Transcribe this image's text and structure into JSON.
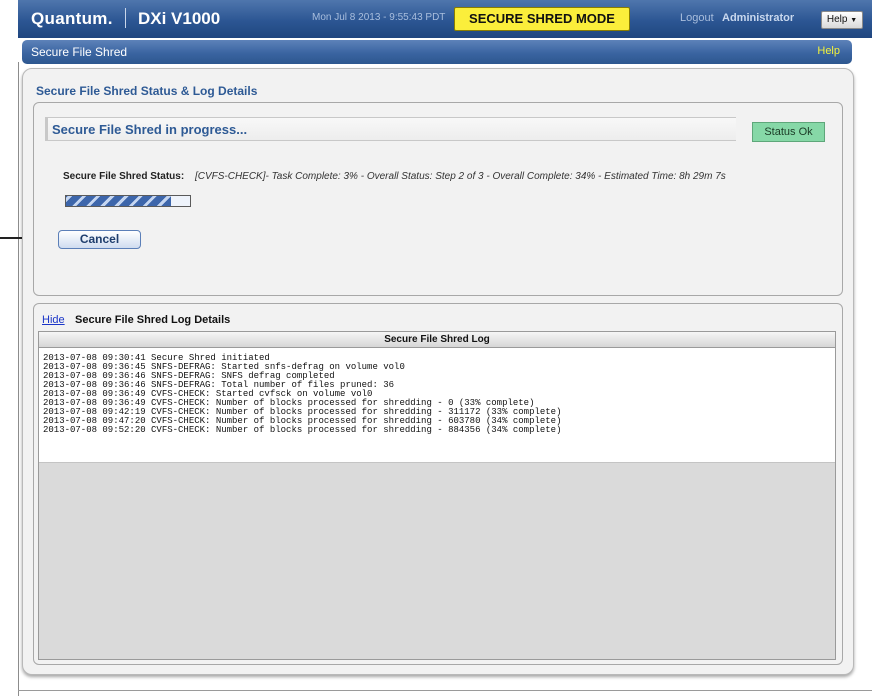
{
  "header": {
    "brand": "Quantum.",
    "product": "DXi V1000",
    "datetime": "Mon Jul 8 2013 - 9:55:43 PDT",
    "mode": "SECURE SHRED MODE",
    "logout": "Logout",
    "user": "Administrator",
    "help_menu": "Help"
  },
  "page": {
    "title": "Secure File Shred",
    "help": "Help"
  },
  "status_section": {
    "title": "Secure File Shred Status & Log Details",
    "progress_title": "Secure File Shred in progress...",
    "status_badge": "Status Ok",
    "status_label": "Secure File Shred Status:",
    "status_value": "[CVFS-CHECK]- Task Complete: 3% - Overall Status: Step 2 of 3 - Overall Complete: 34% - Estimated Time: 8h 29m 7s",
    "progress_fraction": 0.85,
    "cancel_label": "Cancel"
  },
  "log_section": {
    "hide_link": "Hide",
    "title": "Secure File Shred Log Details",
    "table_header": "Secure File Shred Log",
    "lines": [
      "2013-07-08 09:30:41 Secure Shred initiated",
      "2013-07-08 09:36:45 SNFS-DEFRAG: Started snfs-defrag on volume vol0",
      "2013-07-08 09:36:46 SNFS-DEFRAG: SNFS defrag completed",
      "2013-07-08 09:36:46 SNFS-DEFRAG: Total number of files pruned: 36",
      "2013-07-08 09:36:49 CVFS-CHECK: Started cvfsck on volume vol0",
      "2013-07-08 09:36:49 CVFS-CHECK: Number of blocks processed for shredding - 0 (33% complete)",
      "2013-07-08 09:42:19 CVFS-CHECK: Number of blocks processed for shredding - 311172 (33% complete)",
      "2013-07-08 09:47:20 CVFS-CHECK: Number of blocks processed for shredding - 603780 (34% complete)",
      "2013-07-08 09:52:20 CVFS-CHECK: Number of blocks processed for shredding - 884356 (34% complete)"
    ]
  },
  "colors": {
    "mode_badge": "#fbee3b",
    "status_ok": "#86d8a7",
    "title_blue": "#2e5a95",
    "header_blue": "#2c5693"
  }
}
